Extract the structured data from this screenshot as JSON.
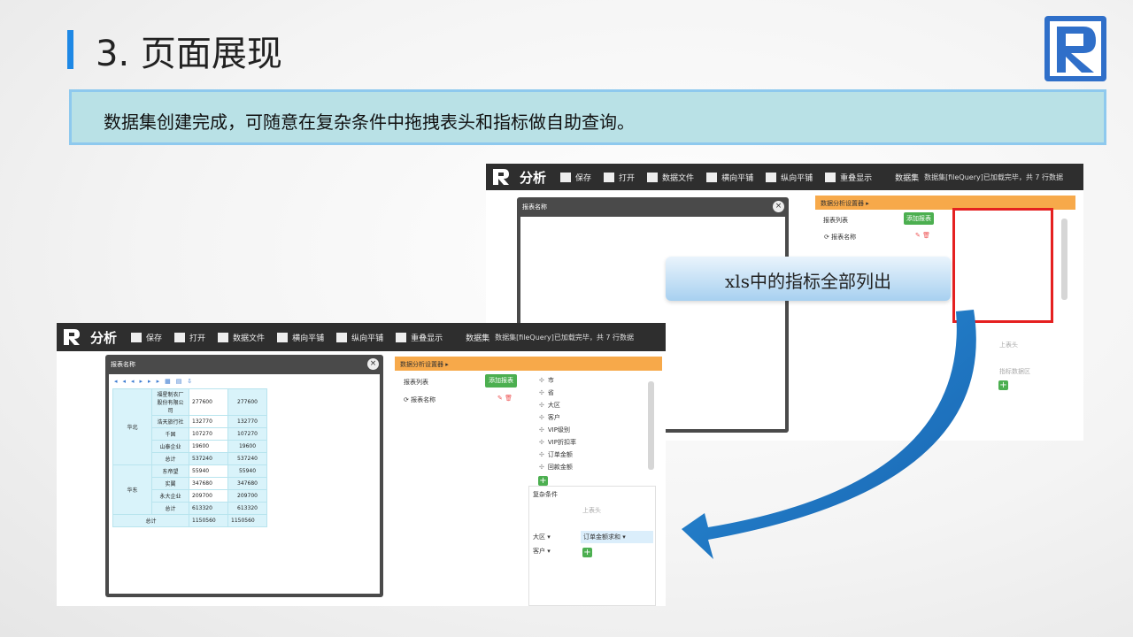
{
  "slide": {
    "title": "3. 页面展现",
    "banner": "数据集创建完成，可随意在复杂条件中拖拽表头和指标做自助查询。",
    "callout": "xls中的指标全部列出",
    "accent_color": "#1e88e5",
    "logo_color": "#2f6fc9"
  },
  "app": {
    "title": "分析",
    "toolbar": [
      {
        "label": "保存",
        "icon": "save-icon"
      },
      {
        "label": "打开",
        "icon": "folder-icon"
      },
      {
        "label": "数据文件",
        "icon": "folder-icon"
      },
      {
        "label": "横向平铺",
        "icon": "columns-icon"
      },
      {
        "label": "纵向平铺",
        "icon": "rows-icon"
      },
      {
        "label": "重叠显示",
        "icon": "cascade-icon"
      }
    ],
    "dataset_label": "数据集",
    "status_back": "数据集[fileQuery]已加载完毕，共 7 行数据",
    "status_front": "数据集[fileQuery]已加载完毕，共 7 行数据",
    "report_window_title": "报表名称",
    "settings_title": "数据分析设置器 ▸",
    "report_list_label": "报表列表",
    "add_report": "添加报表",
    "report_name_item": "报表名称",
    "fields": [
      "市",
      "省",
      "大区",
      "客户",
      "VIP级别",
      "VIP折扣率",
      "订单金额",
      "回款金额"
    ],
    "complex_label": "复杂条件",
    "top_header_hint": "上表头",
    "metric_hint": "指标数据区",
    "row_dims": [
      "大区 ▾",
      "客户 ▾"
    ],
    "metric_item": "订单金额求和 ▾"
  },
  "report_table": {
    "groups": [
      {
        "region": "华北",
        "rows": [
          {
            "name": "福星制衣厂股份有限公司",
            "v1": "277600",
            "v2": "277600"
          },
          {
            "name": "浩天旅行社",
            "v1": "132770",
            "v2": "132770"
          },
          {
            "name": "千固",
            "v1": "107270",
            "v2": "107270"
          },
          {
            "name": "山泰企业",
            "v1": "19600",
            "v2": "19600"
          },
          {
            "name": "总计",
            "v1": "537240",
            "v2": "537240"
          }
        ]
      },
      {
        "region": "华东",
        "rows": [
          {
            "name": "东帝望",
            "v1": "55940",
            "v2": "55940"
          },
          {
            "name": "实翼",
            "v1": "347680",
            "v2": "347680"
          },
          {
            "name": "永大企业",
            "v1": "209700",
            "v2": "209700"
          },
          {
            "name": "总计",
            "v1": "613320",
            "v2": "613320"
          }
        ]
      }
    ],
    "grand_total": {
      "name": "总计",
      "v1": "1150560",
      "v2": "1150560"
    }
  }
}
